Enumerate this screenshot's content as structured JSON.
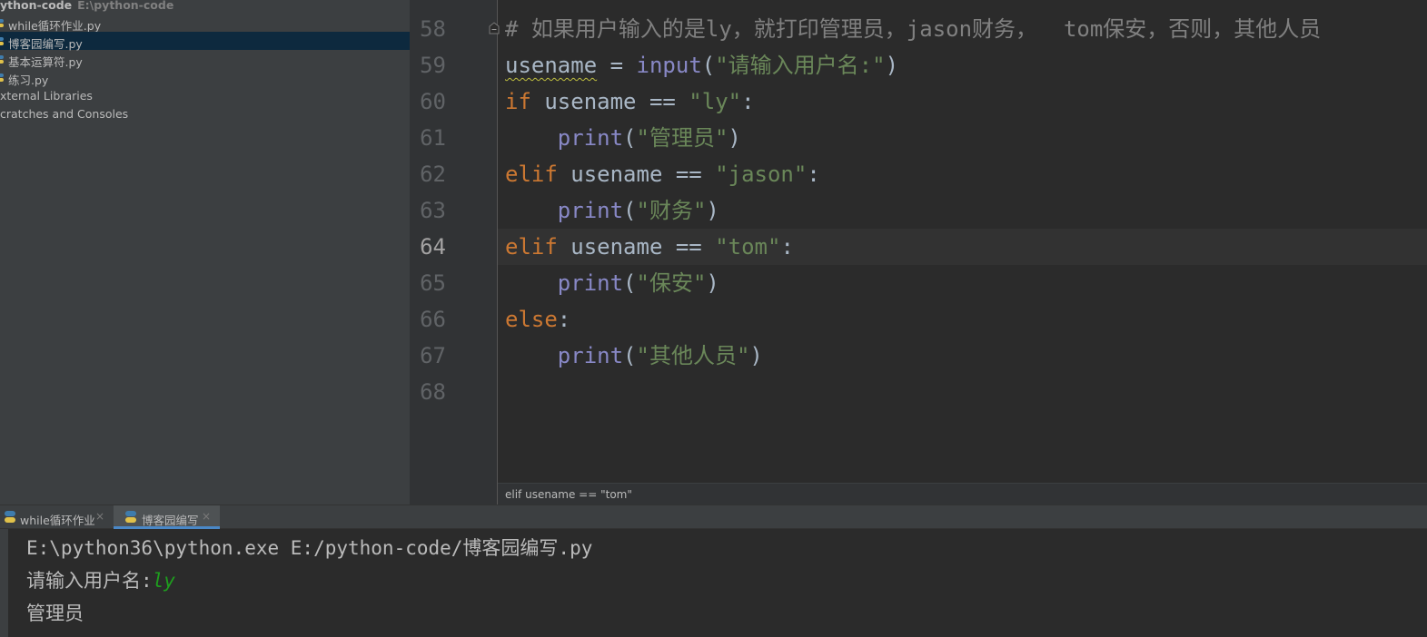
{
  "project": {
    "root_name": "ython-code",
    "root_path": "E:\\python-code",
    "files": [
      {
        "label": "while循环作业.py"
      },
      {
        "label": "博客园编写.py"
      },
      {
        "label": "基本运算符.py"
      },
      {
        "label": "练习.py"
      }
    ],
    "external_libraries": "xternal Libraries",
    "scratches": "cratches and Consoles"
  },
  "editor": {
    "line_numbers": [
      "58",
      "59",
      "60",
      "61",
      "62",
      "63",
      "64",
      "65",
      "66",
      "67",
      "68"
    ],
    "current_line": "64",
    "lines": {
      "l58": {
        "comment": "# 如果用户输入的是ly，就打印管理员，jason财务，  tom保安，否则，其他人员"
      },
      "l59": {
        "var": "usename",
        "op": " = ",
        "fn": "input",
        "p1": "(",
        "str": "\"请输入用户名:\"",
        "p2": ")"
      },
      "l60": {
        "kw": "if",
        "rest": " usename == ",
        "str": "\"ly\"",
        "end": ":"
      },
      "l61": {
        "indent": "    ",
        "fn": "print",
        "p1": "(",
        "str": "\"管理员\"",
        "p2": ")"
      },
      "l62": {
        "kw": "elif",
        "rest": " usename == ",
        "str": "\"jason\"",
        "end": ":"
      },
      "l63": {
        "indent": "    ",
        "fn": "print",
        "p1": "(",
        "str": "\"财务\"",
        "p2": ")"
      },
      "l64": {
        "kw": "elif",
        "rest": " usename == ",
        "str": "\"tom\"",
        "end": ":"
      },
      "l65": {
        "indent": "    ",
        "fn": "print",
        "p1": "(",
        "str": "\"保安\"",
        "p2": ")"
      },
      "l66": {
        "kw": "else",
        "end": ":"
      },
      "l67": {
        "indent": "    ",
        "fn": "print",
        "p1": "(",
        "str": "\"其他人员\"",
        "p2": ")"
      }
    },
    "breadcrumb": "elif usename == \"tom\""
  },
  "run_tabs": [
    {
      "label": "while循环作业",
      "close": "×"
    },
    {
      "label": "博客园编写",
      "close": "×"
    }
  ],
  "console": {
    "command": "E:\\python36\\python.exe E:/python-code/博客园编写.py",
    "prompt": "请输入用户名:",
    "input": "ly",
    "output": "管理员"
  },
  "colors": {
    "keyword": "#cc7832",
    "string": "#6a8759",
    "builtin": "#8888c6",
    "comment": "#808080",
    "selection": "#0d293e",
    "console_input": "#1e9e1e"
  }
}
